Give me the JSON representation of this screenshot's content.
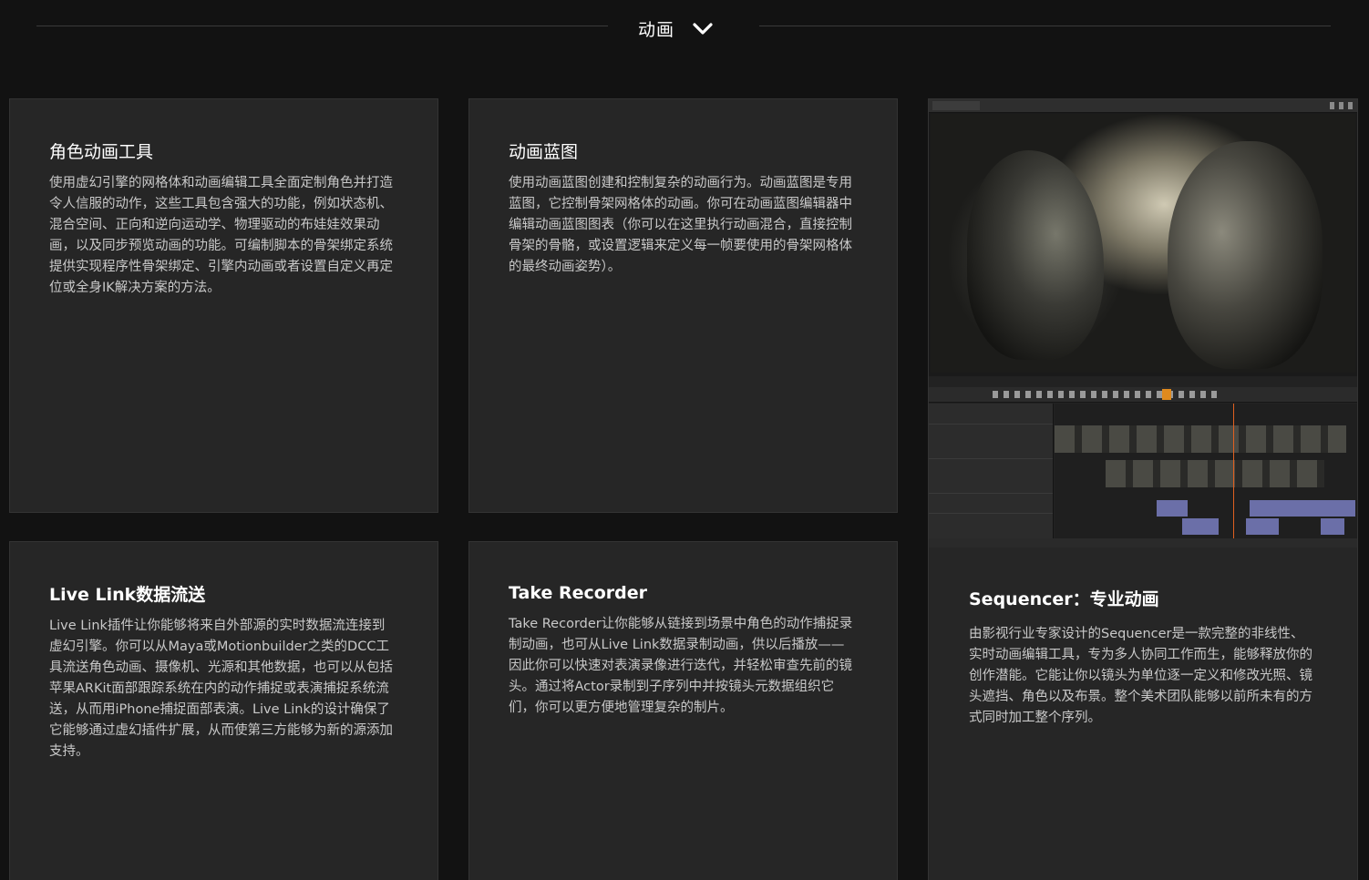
{
  "section": {
    "title": "动画",
    "toggle_icon": "chevron-down-icon"
  },
  "cards": [
    {
      "title": "角色动画工具",
      "description": "使用虚幻引擎的网格体和动画编辑工具全面定制角色并打造令人信服的动作，这些工具包含强大的功能，例如状态机、混合空间、正向和逆向运动学、物理驱动的布娃娃效果动画，以及同步预览动画的功能。可编制脚本的骨架绑定系统提供实现程序性骨架绑定、引擎内动画或者设置自定义再定位或全身IK解决方案的方法。"
    },
    {
      "title": "动画蓝图",
      "description": "使用动画蓝图创建和控制复杂的动画行为。动画蓝图是专用蓝图，它控制骨架网格体的动画。你可在动画蓝图编辑器中编辑动画蓝图图表（你可以在这里执行动画混合，直接控制骨架的骨骼，或设置逻辑来定义每一帧要使用的骨架网格体的最终动画姿势）。"
    },
    {
      "title": "Sequencer：专业动画",
      "description": "由影视行业专家设计的Sequencer是一款完整的非线性、实时动画编辑工具，专为多人协同工作而生，能够释放你的创作潜能。它能让你以镜头为单位逐一定义和修改光照、镜头遮挡、角色以及布景。整个美术团队能够以前所未有的方式同时加工整个序列。"
    },
    {
      "title": "Live Link数据流送",
      "description": "Live Link插件让你能够将来自外部源的实时数据流连接到虚幻引擎。你可以从Maya或Motionbuilder之类的DCC工具流送角色动画、摄像机、光源和其他数据，也可以从包括苹果ARKit面部跟踪系统在内的动作捕捉或表演捕捉系统流送，从而用iPhone捕捉面部表演。Live Link的设计确保了它能够通过虚幻插件扩展，从而使第三方能够为新的源添加支持。"
    },
    {
      "title": "Take Recorder",
      "description": "Take Recorder让你能够从链接到场景中角色的动作捕捉录制动画，也可从Live Link数据录制动画，供以后播放——因此你可以快速对表演录像进行迭代，并轻松审查先前的镜头。通过将Actor录制到子序列中并按镜头元数据组织它们，你可以更方便地管理复杂的制片。"
    }
  ],
  "colors": {
    "background": "#121212",
    "card": "#262626",
    "title": "#ffffff",
    "text": "#c9c9c9",
    "accent_orange": "#e08a1e"
  }
}
